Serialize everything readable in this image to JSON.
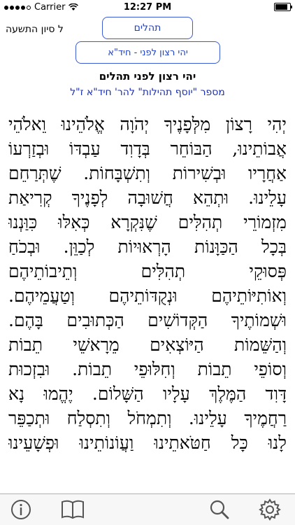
{
  "status_bar": {
    "carrier": "Carrier",
    "time": "12:27 PM",
    "battery_level": 0.9
  },
  "nav": {
    "progress_text": "ל סיון התשעה",
    "tehillim_button": "תהלים",
    "prayer_button": "יהי רצון לפני - חיד\"א"
  },
  "content": {
    "heading": "יהי רצון לפני תהלים",
    "subheading": "מספר \"יוסף תהילות\" להר' חיד\"א ז\"ל",
    "lines": [
      "יְהִי רָצוֹן מִלְּפָנֶיךָ יְהֹוָה אֱלֹהֵינוּ וֵאלֹהֵי",
      "אֲבוֹתֵינוּ, הַבּוֹחֵר בְּדָוִד עַבְדּוֹ וּבְזַרְעוֹ",
      "אַחֲרָיו וּבְשִׁירוֹת וְתִשְׁבָּחוֹת. שֶׁתְּרַחֵם",
      "עָלֵינוּ. וּתְהֵא חֲשׁוּבָה לְפָנֶיךָ קְרִיאַת",
      "מִזְמוֹרֵי תְהִלִּים שֶׁנִּקְרָא כְּאִלּוּ כִּוַּנְנוּ",
      "בְּכָל הַכַּוָּנוֹת הָרְאוּיוֹת לְכַוֵּן. וּבְכֹחַ",
      "פְּסוּקֵי תְהִלִּים וְתֵיבוֹתֵיהֶם",
      "וְאוֹתִיּוֹתֵיהֶם וּנְקֻדּוֹתֵיהֶם וְטַעֲמֵיהֶם.",
      "וּשְׁמוֹתֶיךָ הַקְּדוֹשִׁים הַכְּתוּבִים בָּהֶם.",
      "וְהַשֵּׁמוֹת הַיּוֹצְאִים מֵרָאשֵׁי תֵבוֹת",
      "וְסוֹפֵי תֵבוֹת וְחִלּוּפֵי תֵבוֹת. וּבִזְכוּת",
      "דָּוִד הַמֶּלֶךְ עָלָיו הַשָּׁלוֹם. יֶהֱמוּ נָא",
      "רַחֲמֶיךָ עָלֵינוּ. וְתִמְחֹל וְתִסְלַח וּתְכַפֵּר",
      "לָנוּ כָּל חַטֹּאתֵינוּ וַעֲוֹנוֹתֵינוּ וּפְשָׁעֵינוּ"
    ]
  },
  "toolbar": {
    "info_icon": "info-icon",
    "book_icon": "book-icon",
    "search_icon": "search-icon",
    "settings_icon": "gear-icon"
  },
  "colors": {
    "accent": "#1f3fc9",
    "subheading": "#1b2fb5",
    "toolbar_bg": "#f7f7f7",
    "icon": "#555555"
  }
}
